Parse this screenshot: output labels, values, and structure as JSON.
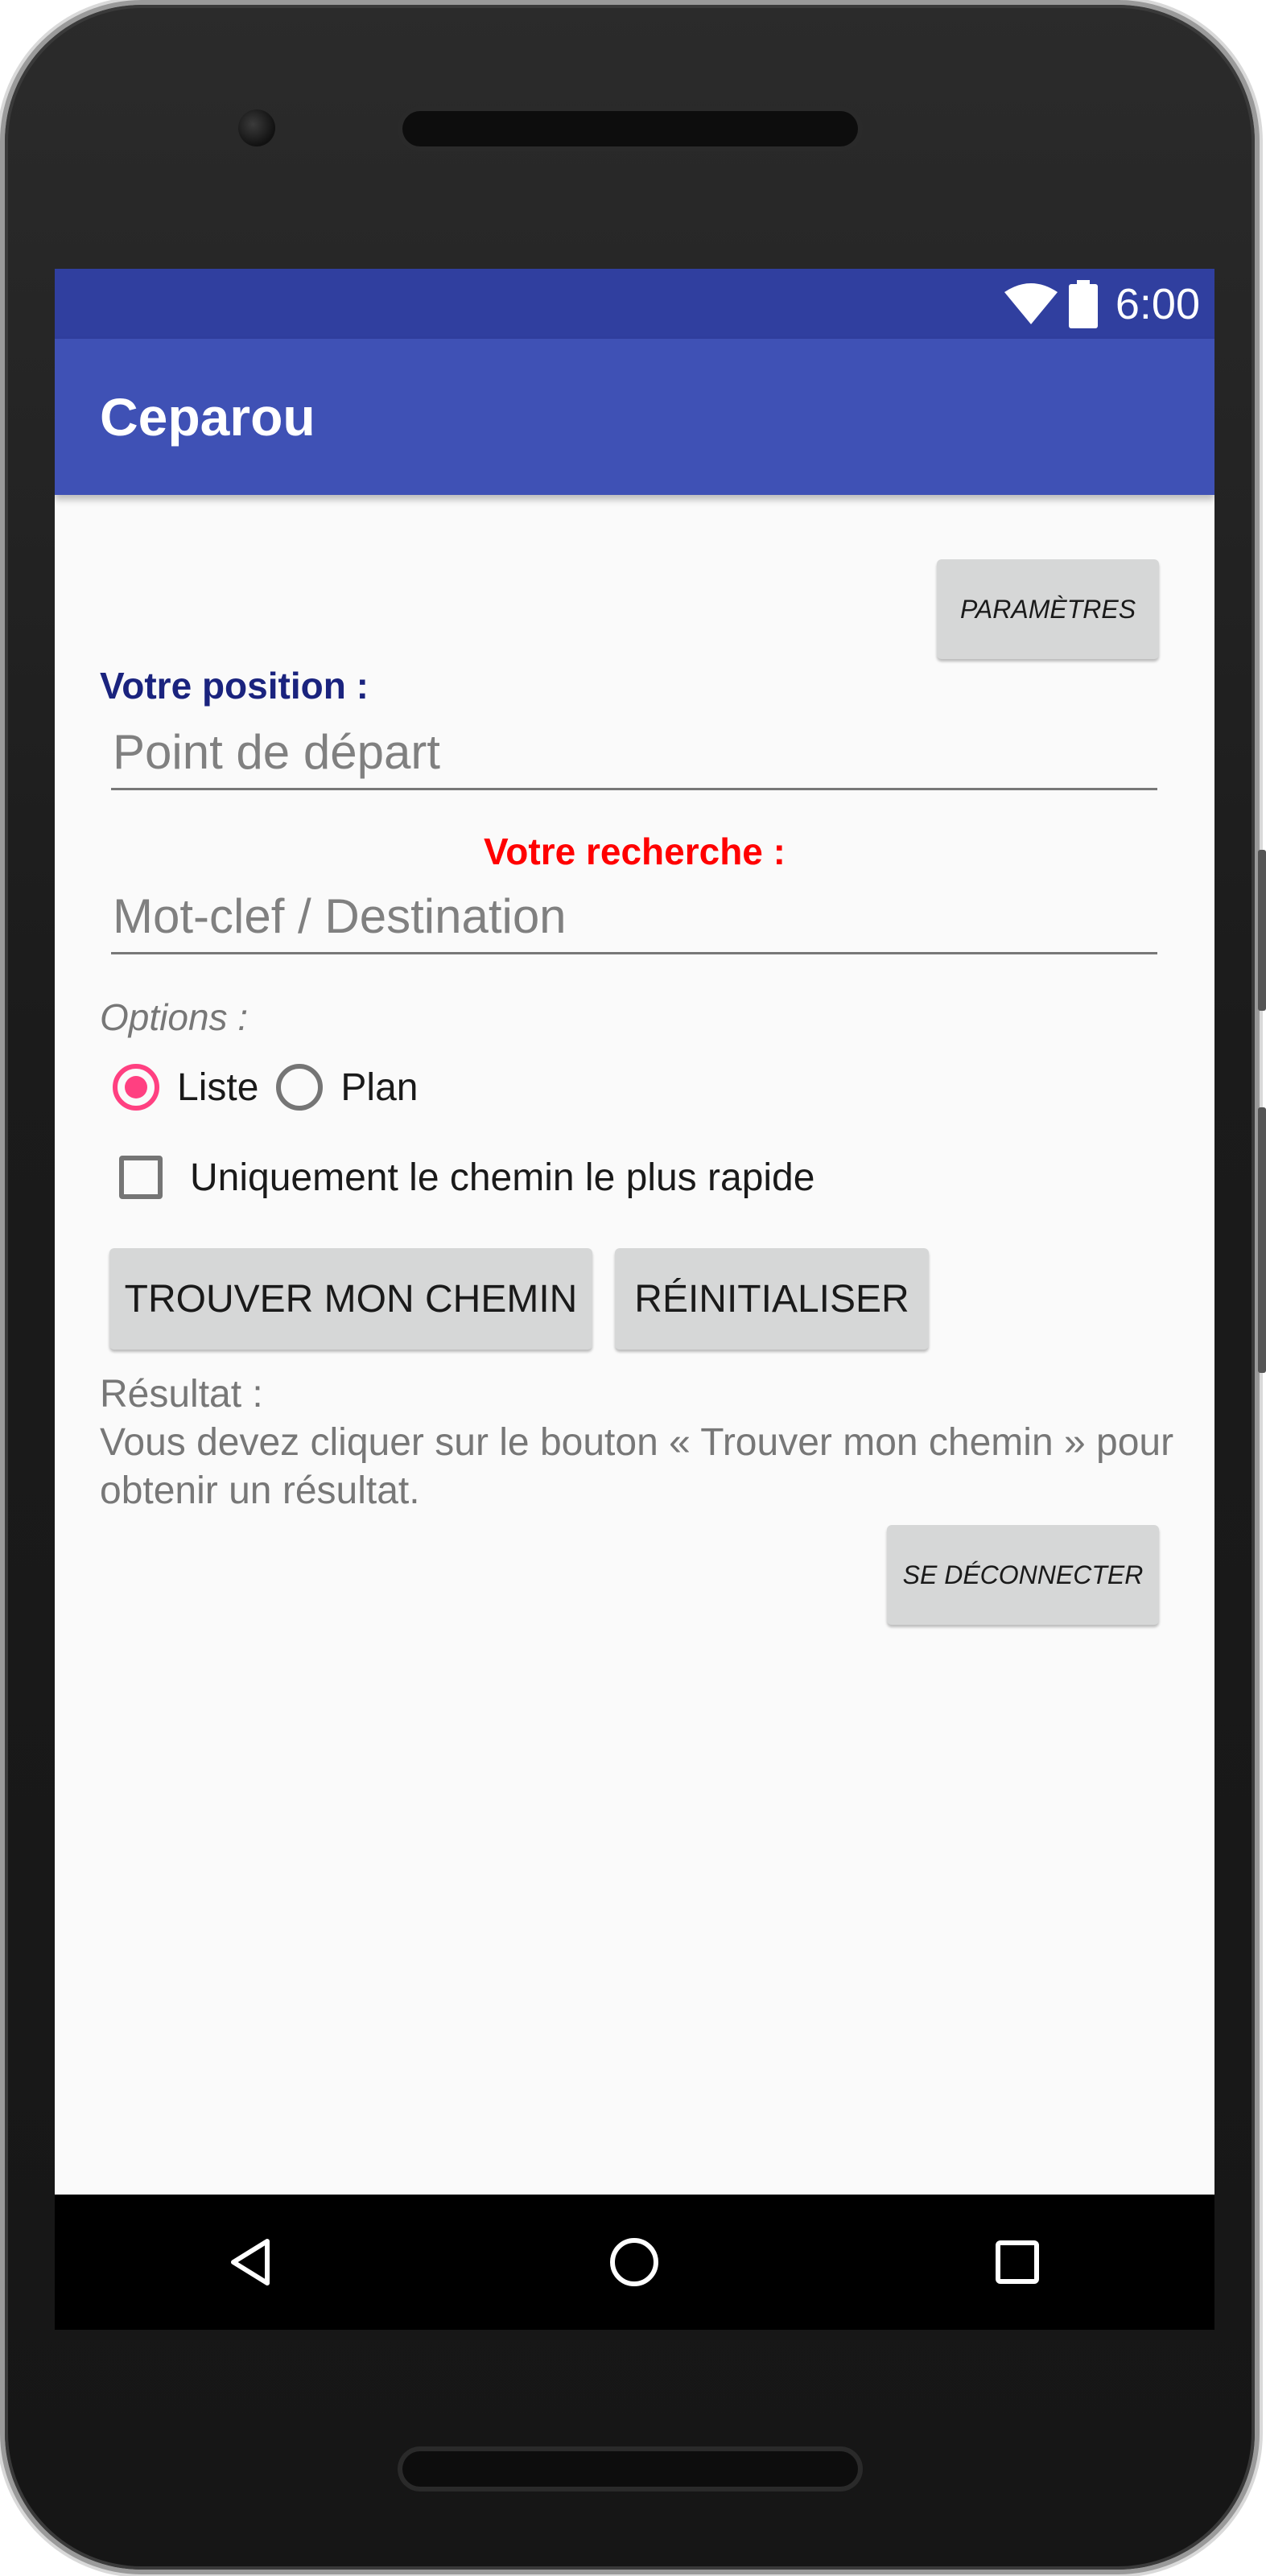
{
  "status_bar": {
    "time": "6:00",
    "icons": [
      "wifi-icon",
      "battery-icon"
    ],
    "color": "#303f9f"
  },
  "app_bar": {
    "title": "Ceparou",
    "color": "#3f51b5"
  },
  "form": {
    "settings_button": "PARAMÈTRES",
    "position_label": "Votre position :",
    "position_placeholder": "Point de départ",
    "search_label": "Votre recherche :",
    "search_placeholder": "Mot-clef / Destination",
    "options_label": "Options :",
    "radio_options": [
      {
        "label": "Liste",
        "checked": true
      },
      {
        "label": "Plan",
        "checked": false
      }
    ],
    "checkbox": {
      "label": "Uniquement le chemin le plus rapide",
      "checked": false
    },
    "find_button": "TROUVER MON CHEMIN",
    "reset_button": "RÉINITIALISER",
    "result_title": "Résultat :",
    "result_message": "Vous devez cliquer sur le bouton « Trouver mon chemin » pour obtenir un résultat.",
    "logout_button": "SE DÉCONNECTER"
  },
  "colors": {
    "position_label": "#1a237e",
    "search_label": "#ff0000",
    "accent": "#ff4081",
    "button_bg": "#d6d7d7"
  },
  "nav_bar": {
    "icons": [
      "back-icon",
      "home-icon",
      "recents-icon"
    ]
  }
}
